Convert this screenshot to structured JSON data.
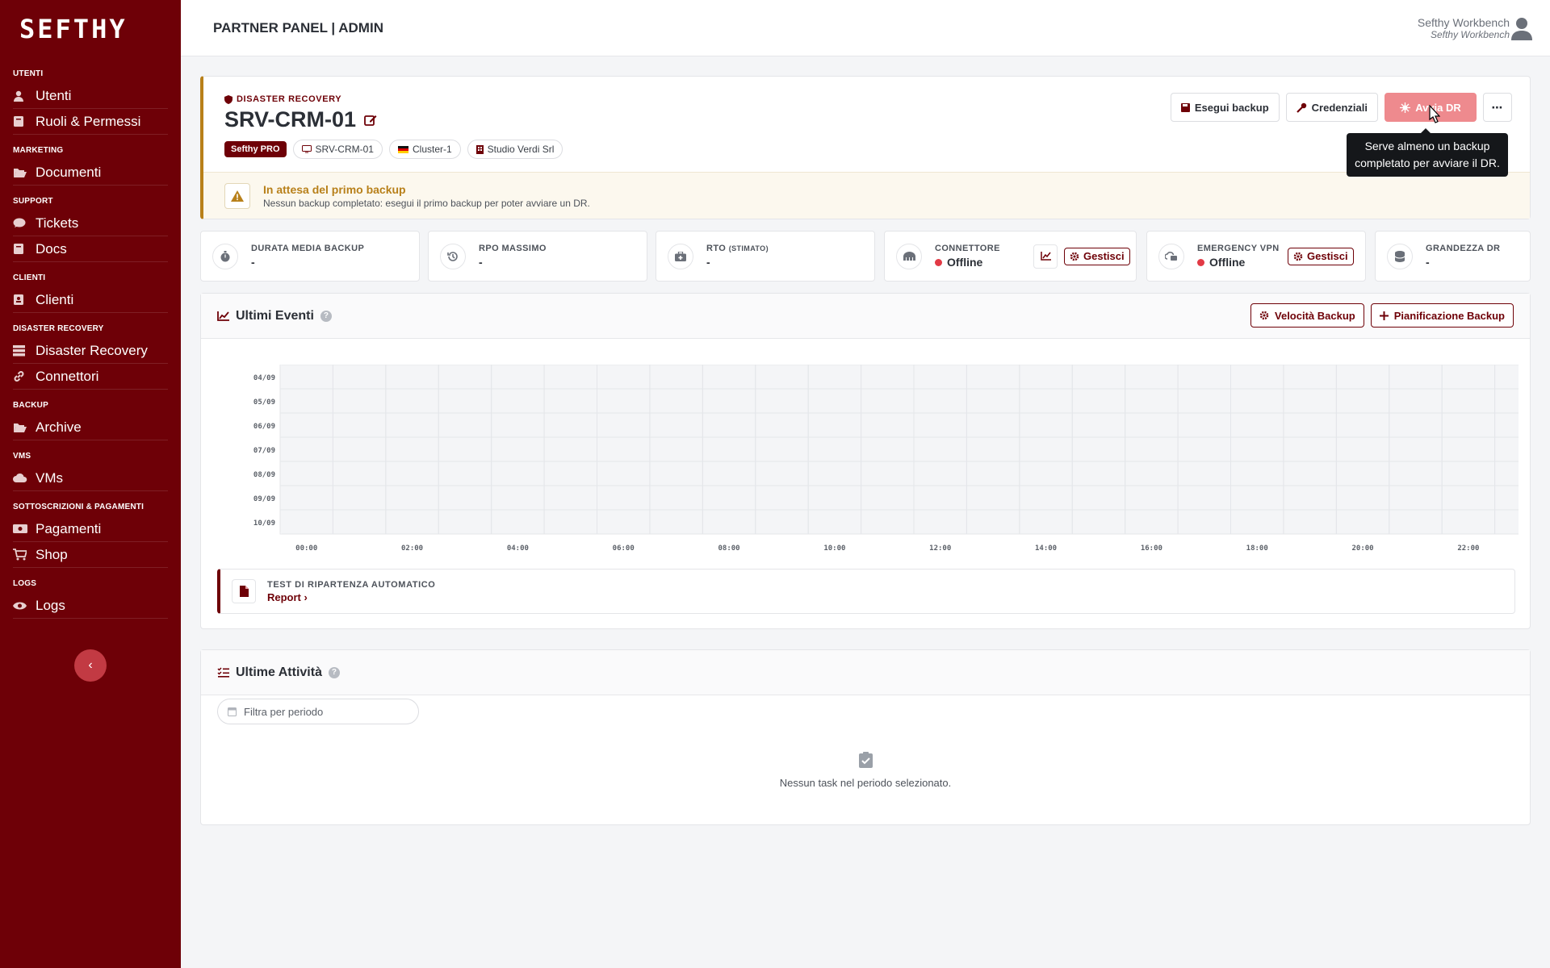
{
  "brand": {
    "logo_text": "SEFTHY",
    "accent": "#6e0007"
  },
  "sidebar": {
    "sections": [
      {
        "title": "UTENTI",
        "items": [
          {
            "label": "Utenti",
            "icon": "user-icon"
          },
          {
            "label": "Ruoli & Permessi",
            "icon": "book-icon"
          }
        ]
      },
      {
        "title": "MARKETING",
        "items": [
          {
            "label": "Documenti",
            "icon": "folder-open-icon"
          }
        ]
      },
      {
        "title": "SUPPORT",
        "items": [
          {
            "label": "Tickets",
            "icon": "chat-icon"
          },
          {
            "label": "Docs",
            "icon": "book-icon"
          }
        ]
      },
      {
        "title": "CLIENTI",
        "items": [
          {
            "label": "Clienti",
            "icon": "contact-book-icon"
          }
        ]
      },
      {
        "title": "DISASTER RECOVERY",
        "items": [
          {
            "label": "Disaster Recovery",
            "icon": "server-icon"
          },
          {
            "label": "Connettori",
            "icon": "link-icon"
          }
        ]
      },
      {
        "title": "BACKUP",
        "items": [
          {
            "label": "Archive",
            "icon": "folder-open-icon"
          }
        ]
      },
      {
        "title": "VMS",
        "items": [
          {
            "label": "VMs",
            "icon": "cloud-icon"
          }
        ]
      },
      {
        "title": "SOTTOSCRIZIONI & PAGAMENTI",
        "items": [
          {
            "label": "Pagamenti",
            "icon": "money-icon"
          },
          {
            "label": "Shop",
            "icon": "cart-icon"
          }
        ]
      },
      {
        "title": "LOGS",
        "items": [
          {
            "label": "Logs",
            "icon": "eye-icon"
          }
        ]
      }
    ]
  },
  "topbar": {
    "title": "PARTNER PANEL | ADMIN",
    "user_name": "Sefthy Workbench",
    "user_sub": "Sefthy Workbench"
  },
  "header": {
    "kicker": "DISASTER RECOVERY",
    "title": "SRV-CRM-01",
    "chips": {
      "plan": "Sefthy PRO",
      "host": "SRV-CRM-01",
      "cluster": "Cluster-1",
      "company": "Studio Verdi Srl"
    },
    "actions": {
      "backup": "Esegui backup",
      "credentials": "Credenziali",
      "dr": "Avvia DR"
    },
    "tooltip": "Serve almeno un backup completato per avviare il DR.",
    "alert": {
      "title": "In attesa del primo backup",
      "text": "Nessun backup completato: esegui il primo backup per poter avviare un DR."
    }
  },
  "stats": {
    "durata": {
      "label": "DURATA MEDIA BACKUP",
      "value": "-"
    },
    "rpo": {
      "label": "RPO MASSIMO",
      "value": "-"
    },
    "rto": {
      "label": "RTO",
      "label_small": "(STIMATO)",
      "value": "-"
    },
    "connettore": {
      "label": "CONNETTORE",
      "value": "Offline",
      "manage": "Gestisci"
    },
    "vpn": {
      "label": "EMERGENCY VPN",
      "value": "Offline",
      "manage": "Gestisci"
    },
    "grandezza": {
      "label": "GRANDEZZA DR",
      "value": "-"
    }
  },
  "events": {
    "title": "Ultimi Eventi",
    "speed_button": "Velocità Backup",
    "schedule_button": "Pianificazione Backup",
    "report_label": "TEST DI RIPARTENZA AUTOMATICO",
    "report_link": "Report ›"
  },
  "chart_data": {
    "type": "heatmap",
    "y_categories": [
      "04/09",
      "05/09",
      "06/09",
      "07/09",
      "08/09",
      "09/09",
      "10/09"
    ],
    "x_tick_labels": [
      "00:00",
      "02:00",
      "04:00",
      "06:00",
      "08:00",
      "10:00",
      "12:00",
      "14:00",
      "16:00",
      "18:00",
      "20:00",
      "22:00"
    ],
    "columns": 24,
    "values": []
  },
  "activities": {
    "title": "Ultime Attività",
    "filter_placeholder": "Filtra per periodo",
    "empty": "Nessun task nel periodo selezionato."
  }
}
